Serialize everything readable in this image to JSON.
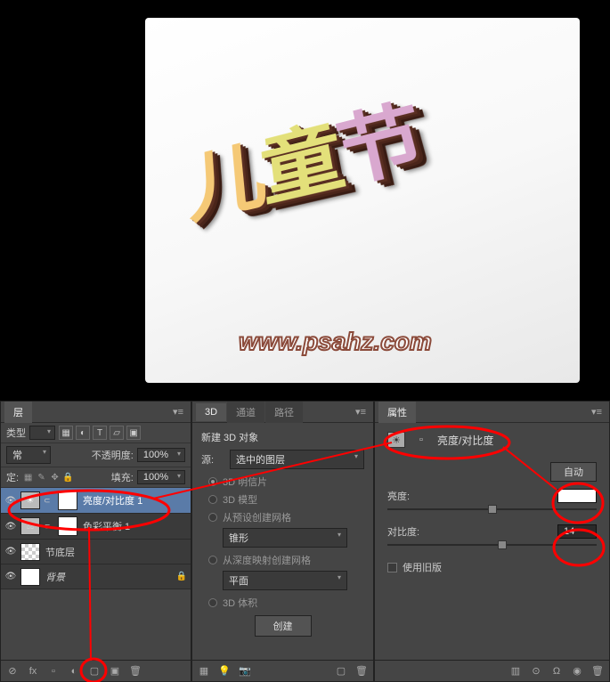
{
  "artwork": {
    "chars": [
      "儿",
      "童",
      "节"
    ],
    "watermark": "www.psahz.com"
  },
  "layers_panel": {
    "tab": "层",
    "type_label": "类型",
    "blend_mode": "常",
    "opacity_label": "不透明度:",
    "opacity_value": "100%",
    "lock_label": "定:",
    "fill_label": "填充:",
    "fill_value": "100%",
    "layers": [
      {
        "name": "亮度/对比度 1",
        "selected": true,
        "has_mask": true,
        "adj": true,
        "adj_glyph": "☀"
      },
      {
        "name": "色彩平衡 1",
        "selected": false,
        "has_mask": true,
        "adj": true,
        "adj_glyph": "⚖"
      },
      {
        "name": "节底层",
        "selected": false,
        "has_mask": false,
        "adj": false,
        "trans": true
      },
      {
        "name": "背景",
        "selected": false,
        "has_mask": false,
        "adj": false,
        "locked": true
      }
    ],
    "footer_icons": [
      "⊘",
      "fx",
      "▫",
      "◐",
      "▢",
      "▣",
      "🗑"
    ]
  },
  "d3_panel": {
    "tabs": [
      "3D",
      "通道",
      "路径"
    ],
    "section": "新建 3D 对象",
    "source_label": "源:",
    "source_value": "选中的图层",
    "options": [
      {
        "label": "3D 明信片",
        "checked": true
      },
      {
        "label": "3D 模型",
        "checked": false
      },
      {
        "label": "从预设创建网格",
        "checked": false,
        "sub": "锥形"
      },
      {
        "label": "从深度映射创建网格",
        "checked": false,
        "sub": "平面"
      },
      {
        "label": "3D 体积",
        "checked": false
      }
    ],
    "create_btn": "创建",
    "footer_icons": [
      "▦",
      "💡",
      "📷",
      "▢",
      "🗑"
    ]
  },
  "props_panel": {
    "tab": "属性",
    "adj_title": "亮度/对比度",
    "auto_btn": "自动",
    "brightness_label": "亮度:",
    "brightness_value": "",
    "contrast_label": "对比度:",
    "contrast_value": "14",
    "legacy_label": "使用旧版",
    "footer_icons": [
      "▥",
      "⊙",
      "Ω",
      "◉",
      "🗑"
    ]
  }
}
